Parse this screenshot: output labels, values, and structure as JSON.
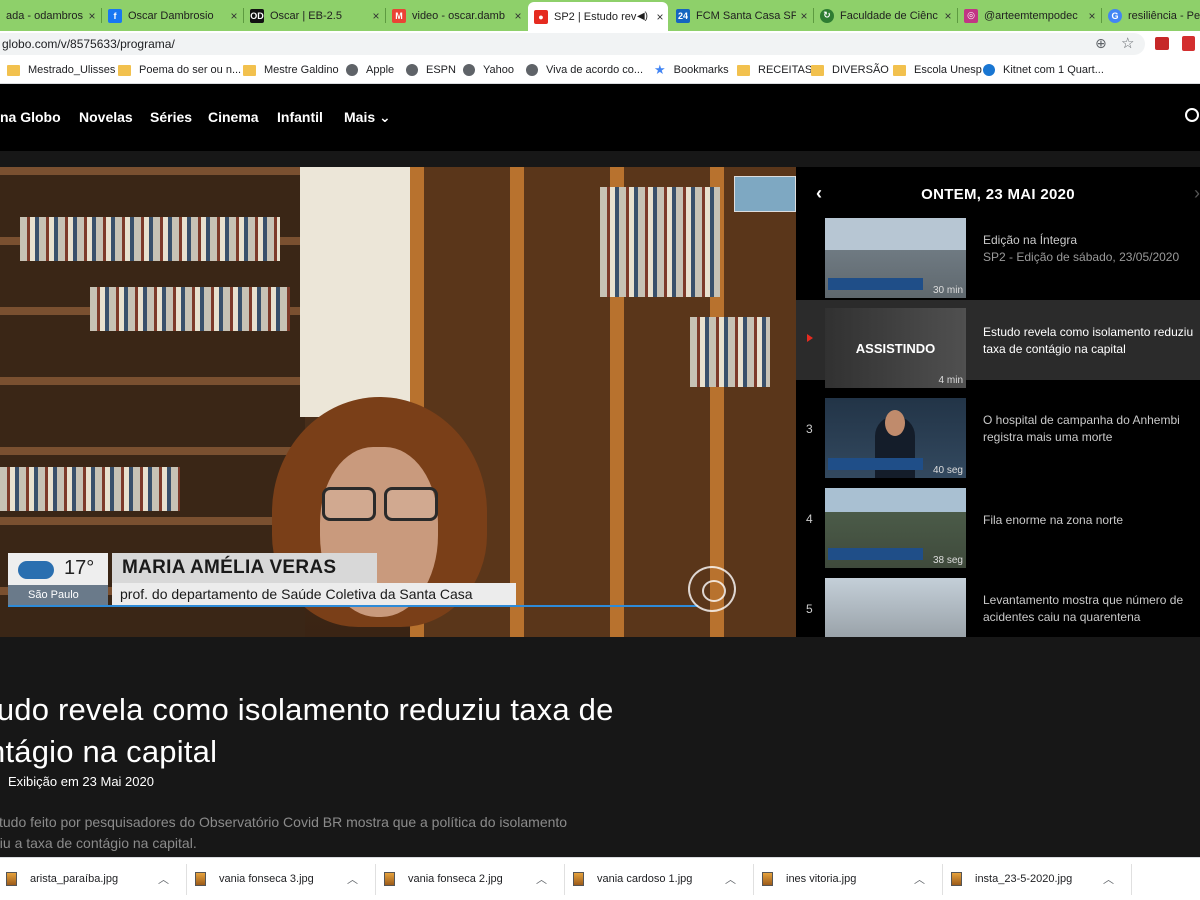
{
  "browser": {
    "tabs": [
      {
        "title": "ada - odambros",
        "icon": "mail-icon",
        "color": "#4a4a4a"
      },
      {
        "title": "Oscar Dambrosio",
        "icon": "facebook-icon",
        "color": "#1877f2"
      },
      {
        "title": "Oscar | EB-2.5",
        "icon": "od-icon",
        "color": "#111111"
      },
      {
        "title": "video - oscar.damb",
        "icon": "gmail-icon",
        "color": "#ea4335"
      },
      {
        "title": "SP2 | Estudo rev",
        "icon": "globoplay-icon",
        "color": "#e52b20",
        "active": true,
        "audio_icon": "speaker-icon"
      },
      {
        "title": "FCM Santa Casa SP",
        "icon": "calendar-icon",
        "color": "#1565c0"
      },
      {
        "title": "Faculdade de Ciênc",
        "icon": "globe-icon",
        "color": "#2e7d32"
      },
      {
        "title": "@arteemtempodec",
        "icon": "instagram-icon",
        "color": "#c13584"
      },
      {
        "title": "resiliência - Pesq",
        "icon": "google-icon",
        "color": "#4285f4"
      }
    ],
    "tab_close": "×",
    "url": "globo.com/v/8575633/programa/",
    "bookmarks": [
      {
        "label": "Mestrado_Ulisses",
        "type": "folder"
      },
      {
        "label": "Poema do ser ou n...",
        "type": "folder"
      },
      {
        "label": "Mestre Galdino",
        "type": "folder"
      },
      {
        "label": "Apple",
        "type": "site"
      },
      {
        "label": "ESPN",
        "type": "site"
      },
      {
        "label": "Yahoo",
        "type": "site"
      },
      {
        "label": "Viva de acordo co...",
        "type": "site"
      },
      {
        "label": "Bookmarks",
        "type": "star"
      },
      {
        "label": "RECEITAS",
        "type": "folder"
      },
      {
        "label": "DIVERSÃO",
        "type": "folder"
      },
      {
        "label": "Escola Unesp",
        "type": "folder"
      },
      {
        "label": "Kitnet com 1 Quart...",
        "type": "site"
      }
    ]
  },
  "site_nav": {
    "items": [
      "na Globo",
      "Novelas",
      "Séries",
      "Cinema",
      "Infantil",
      "Mais"
    ],
    "more_icon": "chevron-down-icon"
  },
  "video": {
    "weather_temp": "17°",
    "weather_city": "São Paulo",
    "name": "MARIA AMÉLIA VERAS",
    "role": "prof. do departamento de Saúde Coletiva da Santa Casa"
  },
  "playlist": {
    "header": "ONTEM, 23 MAI 2020",
    "items": [
      {
        "num": "",
        "title": "Edição na Íntegra",
        "subtitle": "SP2 - Edição de sábado, 23/05/2020",
        "duration": "30 min",
        "caption": "DOIS MESES DE QUARENTENA"
      },
      {
        "num": "",
        "title": "Estudo revela como isolamento reduziu taxa de contágio na capital",
        "subtitle": "",
        "duration": "4 min",
        "badge": "ASSISTINDO",
        "active": true
      },
      {
        "num": "3",
        "title": "O hospital de campanha do Anhembi registra mais uma morte",
        "subtitle": "",
        "duration": "40 seg"
      },
      {
        "num": "4",
        "title": "Fila enorme na zona norte",
        "subtitle": "",
        "duration": "38 seg"
      },
      {
        "num": "5",
        "title": "Levantamento mostra que número de acidentes caiu na quarentena",
        "subtitle": "",
        "duration": ""
      }
    ]
  },
  "info": {
    "title": "tudo revela como isolamento reduziu taxa de ntágio na capital",
    "title_line1": "tudo revela como isolamento reduziu taxa de",
    "title_line2": "ntágio na capital",
    "date": "Exibição em 23 Mai 2020",
    "desc_line1": "studo feito por pesquisadores do Observatório Covid BR mostra que a política do isolamento",
    "desc_line2": "uiu a taxa de contágio na capital."
  },
  "downloads": [
    "arista_paraíba.jpg",
    "vania fonseca 3.jpg",
    "vania fonseca 2.jpg",
    "vania cardoso 1.jpg",
    "ines vitoria.jpg",
    "insta_23-5-2020.jpg"
  ]
}
